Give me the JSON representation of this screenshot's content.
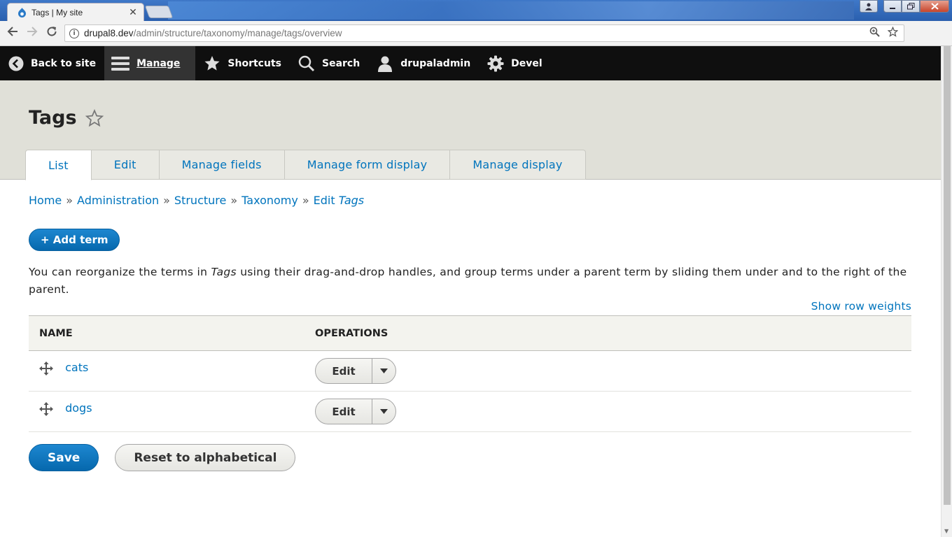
{
  "browser": {
    "tab_title": "Tags | My site",
    "tab_close": "✕",
    "url_host": "drupal8.dev",
    "url_path": "/admin/structure/taxonomy/manage/tags/overview"
  },
  "admin_bar": {
    "back": "Back to site",
    "manage": "Manage",
    "shortcuts": "Shortcuts",
    "search": "Search",
    "user": "drupaladmin",
    "devel": "Devel"
  },
  "page": {
    "title": "Tags",
    "tabs": [
      "List",
      "Edit",
      "Manage fields",
      "Manage form display",
      "Manage display"
    ]
  },
  "breadcrumb": {
    "items": [
      "Home",
      "Administration",
      "Structure",
      "Taxonomy"
    ],
    "last_prefix": "Edit",
    "last_em": "Tags",
    "separator": "»"
  },
  "add_term": "+ Add term",
  "help": {
    "before": "You can reorganize the terms in",
    "em": "Tags",
    "after": "using their drag-and-drop handles, and group terms under a parent term by sliding them under and to the right of the parent."
  },
  "show_row_weights": "Show row weights",
  "table": {
    "headers": [
      "NAME",
      "OPERATIONS"
    ],
    "rows": [
      {
        "name": "cats",
        "op": "Edit"
      },
      {
        "name": "dogs",
        "op": "Edit"
      }
    ]
  },
  "buttons": {
    "save": "Save",
    "reset": "Reset to alphabetical"
  }
}
